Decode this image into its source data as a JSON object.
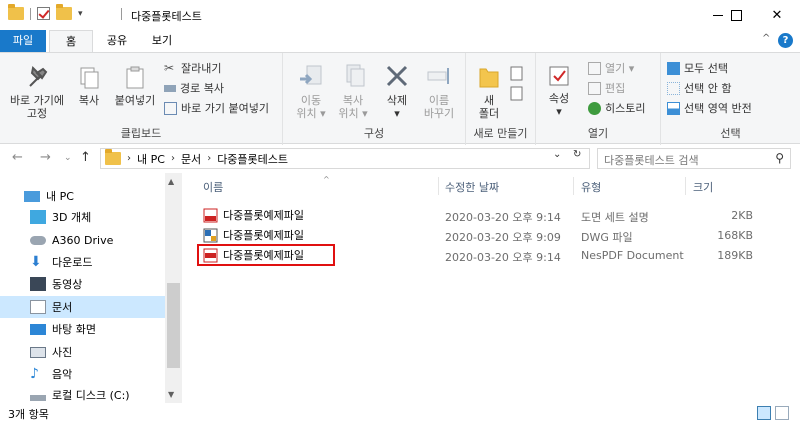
{
  "window": {
    "title": "다중플롯테스트",
    "controls": {
      "minimize": "minimize",
      "maximize": "maximize",
      "close": "close"
    }
  },
  "tabs": [
    {
      "label": "파일"
    },
    {
      "label": "홈"
    },
    {
      "label": "공유"
    },
    {
      "label": "보기"
    }
  ],
  "ribbon": {
    "clipboard": {
      "label": "클립보드",
      "pin": "바로 가기에\n고정",
      "copy": "복사",
      "paste": "붙여넣기",
      "cut": "잘라내기",
      "copy_path": "경로 복사",
      "paste_shortcut": "바로 가기 붙여넣기"
    },
    "organize": {
      "label": "구성",
      "move_to": "이동\n위치 ▾",
      "copy_to": "복사\n위치 ▾",
      "delete": "삭제\n▾",
      "rename": "이름\n바꾸기"
    },
    "new": {
      "label": "새로 만들기",
      "new_folder": "새\n폴더"
    },
    "open": {
      "label": "열기",
      "properties": "속성\n▾",
      "open": "열기 ▾",
      "edit": "편집",
      "history": "히스토리"
    },
    "select": {
      "label": "선택",
      "select_all": "모두 선택",
      "select_none": "선택 안 함",
      "invert": "선택 영역 반전"
    }
  },
  "address": {
    "segments": [
      "내 PC",
      "문서",
      "다중플롯테스트"
    ],
    "search_placeholder": "다중플롯테스트 검색"
  },
  "nav": {
    "items": [
      {
        "label": "내 PC",
        "icon": "pc-icon"
      },
      {
        "label": "3D 개체",
        "icon": "cube-icon"
      },
      {
        "label": "A360 Drive",
        "icon": "cloud-icon"
      },
      {
        "label": "다운로드",
        "icon": "download-icon"
      },
      {
        "label": "동영상",
        "icon": "video-icon"
      },
      {
        "label": "문서",
        "icon": "document-icon"
      },
      {
        "label": "바탕 화면",
        "icon": "desktop-icon"
      },
      {
        "label": "사진",
        "icon": "picture-icon"
      },
      {
        "label": "음악",
        "icon": "music-icon"
      },
      {
        "label": "로컬 디스크 (C:)",
        "icon": "disk-icon"
      }
    ]
  },
  "columns": {
    "name": "이름",
    "modified": "수정한 날짜",
    "type": "유형",
    "size": "크기"
  },
  "files": [
    {
      "name": "다중플롯예제파일",
      "modified": "2020-03-20 오후 9:14",
      "type": "도면 세트 설명",
      "size": "2KB",
      "icon": "dsd-file-icon"
    },
    {
      "name": "다중플롯예제파일",
      "modified": "2020-03-20 오후 9:09",
      "type": "DWG 파일",
      "size": "168KB",
      "icon": "dwg-file-icon"
    },
    {
      "name": "다중플롯예제파일",
      "modified": "2020-03-20 오후 9:14",
      "type": "NesPDF Document",
      "size": "189KB",
      "icon": "pdf-file-icon"
    }
  ],
  "status": {
    "count": "3개 항목"
  }
}
